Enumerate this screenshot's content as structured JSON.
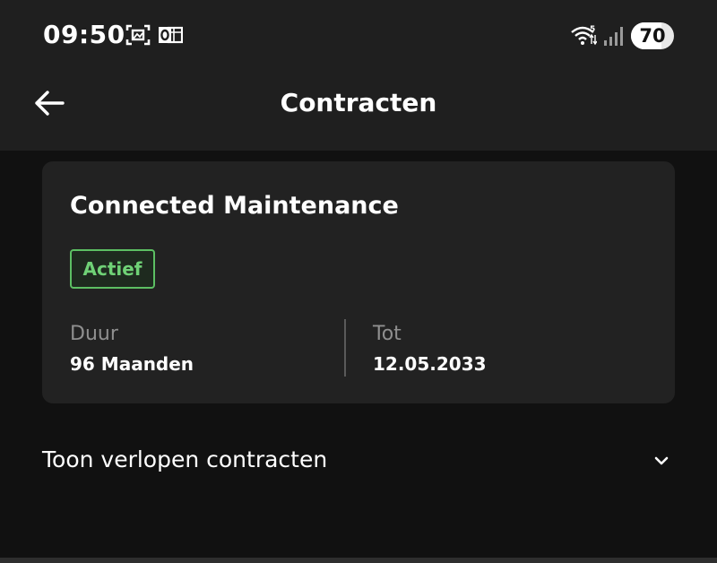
{
  "status_bar": {
    "time": "09:50",
    "battery_level": "70",
    "icons": [
      "screenshot-icon",
      "outlook-icon",
      "wifi-icon",
      "signal-icon"
    ]
  },
  "header": {
    "title": "Contracten",
    "back_icon": "arrow-left-icon"
  },
  "contract_card": {
    "title": "Connected Maintenance",
    "status": "Actief",
    "status_color": "#5cbf63",
    "duration_label": "Duur",
    "duration_value": "96 Maanden",
    "until_label": "Tot",
    "until_value": "12.05.2033"
  },
  "expired_section": {
    "label": "Toon verlopen contracten",
    "icon": "chevron-down-icon"
  },
  "colors": {
    "background": "#111111",
    "header_background": "#1f1f1f",
    "card_background": "#222222",
    "accent_green": "#5cbf63"
  }
}
